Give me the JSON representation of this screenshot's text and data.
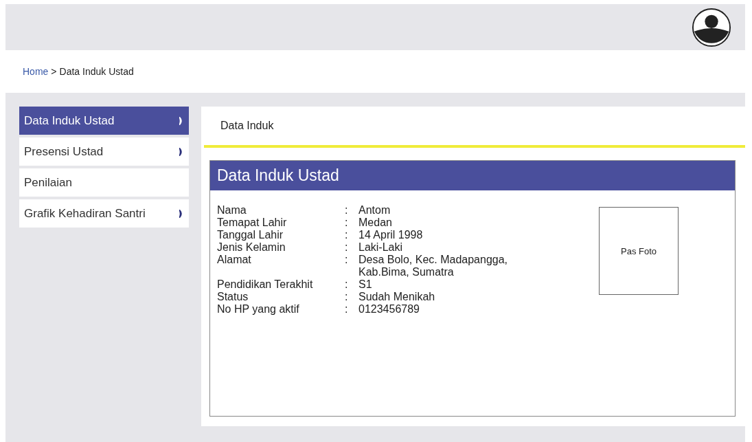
{
  "breadcrumb": {
    "home": "Home",
    "separator": ">",
    "current": "Data Induk Ustad"
  },
  "sidebar": {
    "items": [
      {
        "label": "Data Induk Ustad",
        "selected": true,
        "arrow": true
      },
      {
        "label": "Presensi Ustad",
        "selected": false,
        "arrow": true
      },
      {
        "label": "Penilaian",
        "selected": false,
        "arrow": false
      },
      {
        "label": "Grafik Kehadiran Santri",
        "selected": false,
        "arrow": true
      }
    ]
  },
  "panel": {
    "tab": "Data Induk",
    "card_title": "Data Induk Ustad",
    "fields": [
      {
        "label": "Nama",
        "separator": ":",
        "value": "Antom"
      },
      {
        "label": "Temapat Lahir",
        "separator": ":",
        "value": "Medan"
      },
      {
        "label": "Tanggal Lahir",
        "separator": ":",
        "value": "14 April 1998"
      },
      {
        "label": "Jenis Kelamin",
        "separator": ":",
        "value": "Laki-Laki"
      },
      {
        "label": "Alamat",
        "separator": ":",
        "value": "Desa Bolo, Kec. Madapangga, Kab.Bima, Sumatra"
      },
      {
        "label": "Pendidikan Terakhit",
        "separator": ":",
        "value": "S1"
      },
      {
        "label": "Status",
        "separator": ":",
        "value": "Sudah Menikah"
      },
      {
        "label": "No HP yang aktif",
        "separator": ":",
        "value": "0123456789"
      }
    ],
    "photo_label": "Pas Foto"
  }
}
